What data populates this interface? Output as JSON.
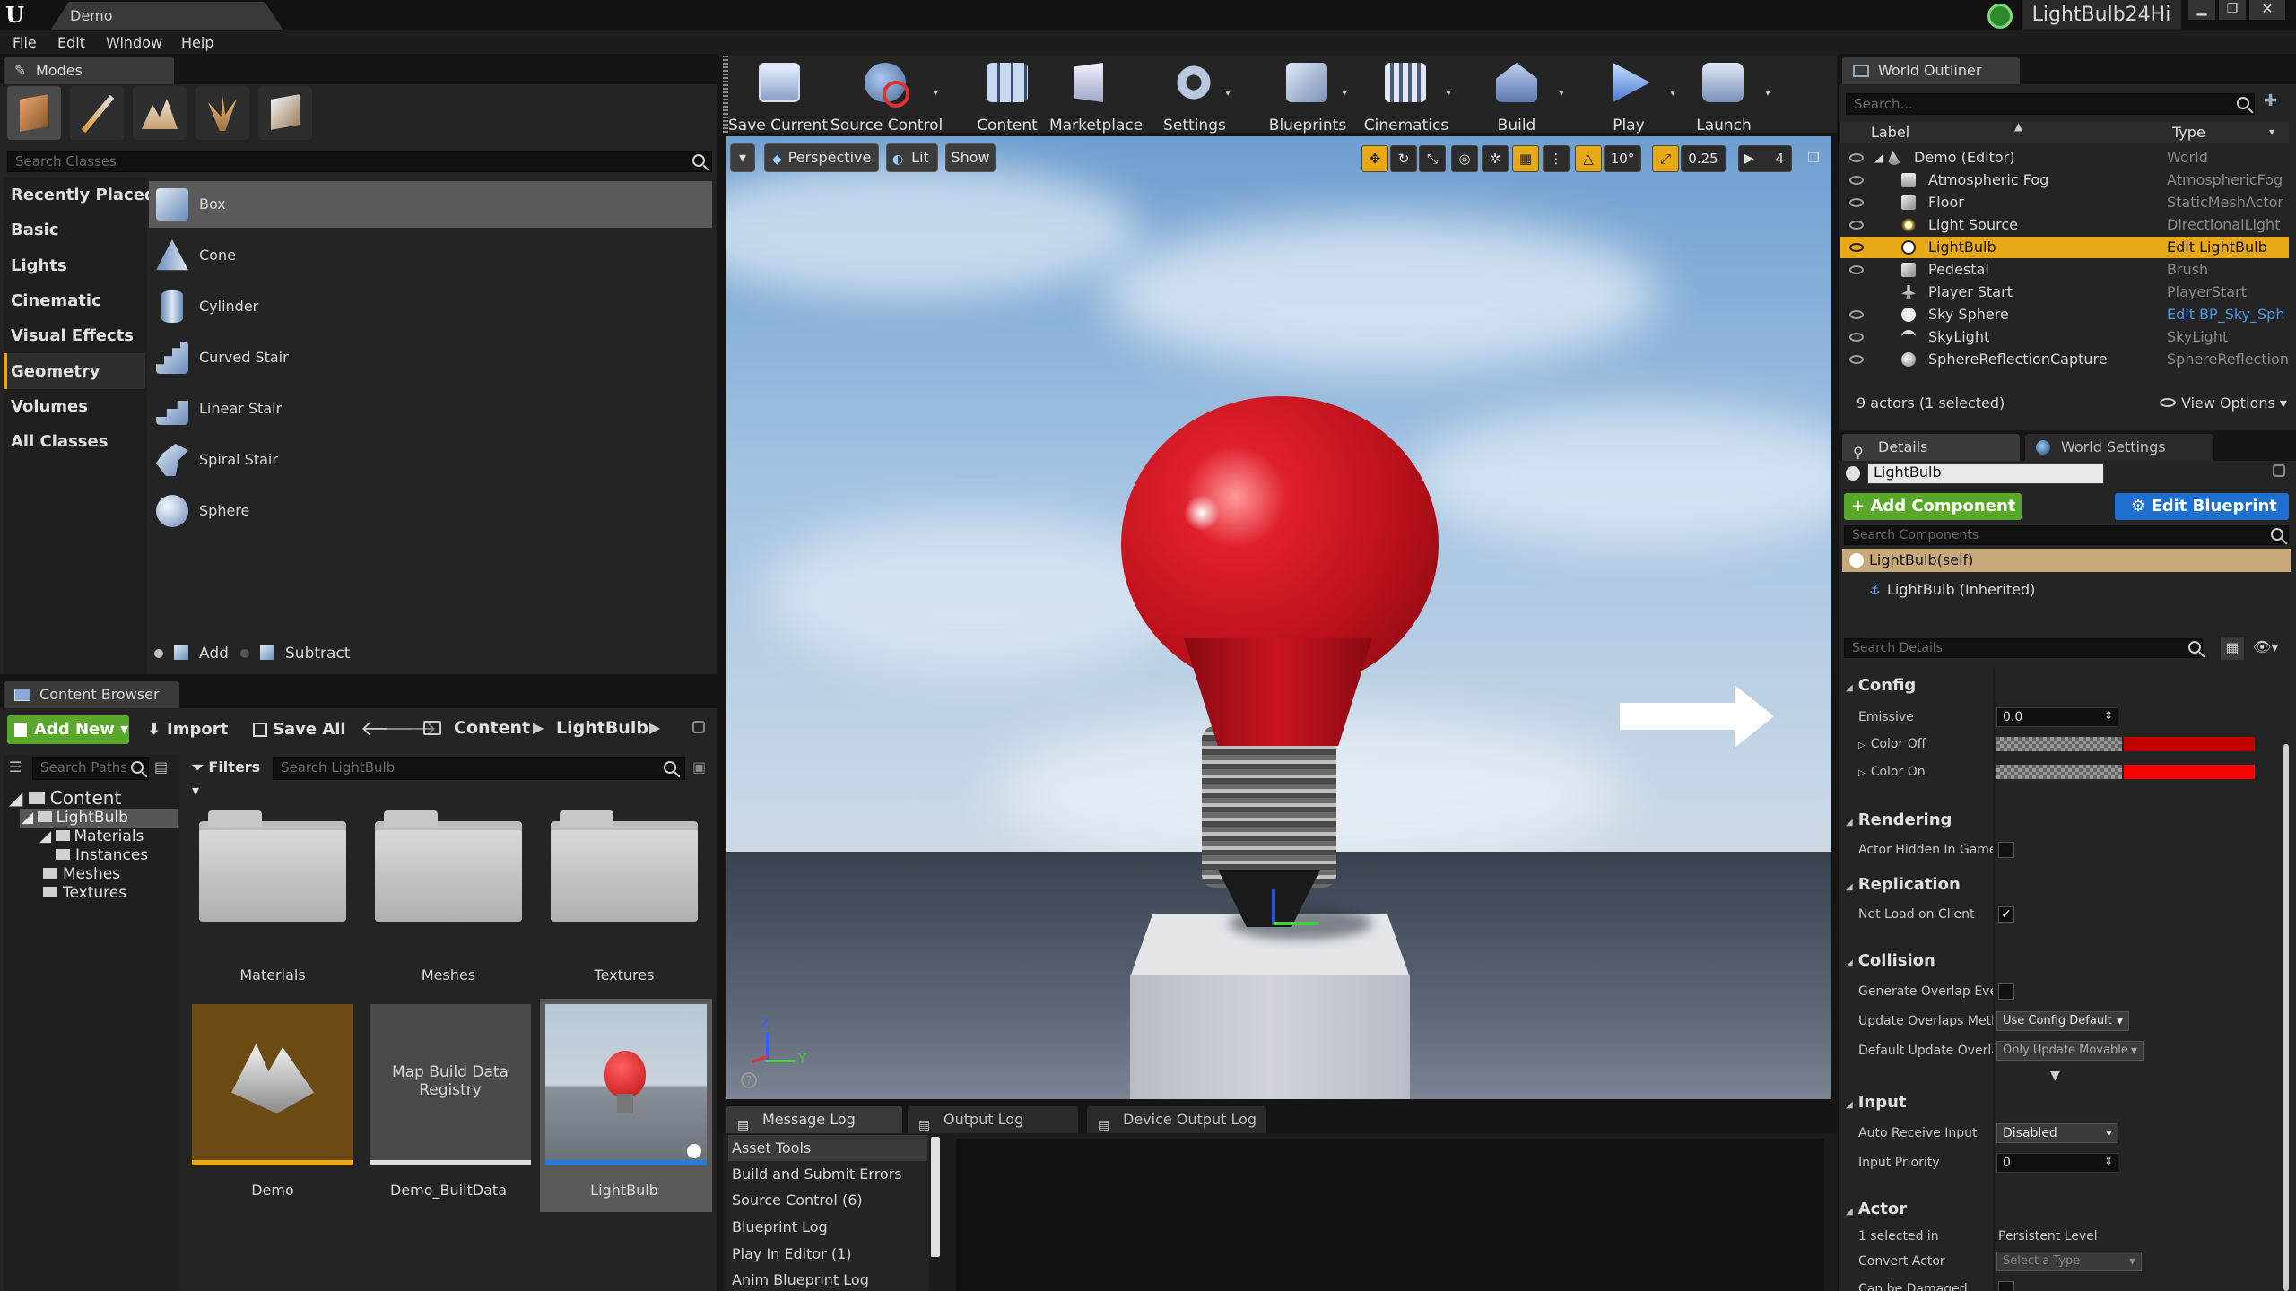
{
  "title_bar": {
    "tab_label": "Demo",
    "project_name": "LightBulb24Hi"
  },
  "menu": [
    "File",
    "Edit",
    "Window",
    "Help"
  ],
  "modes": {
    "title": "Modes",
    "search_placeholder": "Search Classes",
    "categories": [
      "Recently Placed",
      "Basic",
      "Lights",
      "Cinematic",
      "Visual Effects",
      "Geometry",
      "Volumes",
      "All Classes"
    ],
    "selected_category": "Geometry",
    "items": [
      "Box",
      "Cone",
      "Cylinder",
      "Curved Stair",
      "Linear Stair",
      "Spiral Stair",
      "Sphere"
    ],
    "add_label": "Add",
    "subtract_label": "Subtract"
  },
  "toolbar": {
    "buttons": [
      "Save Current",
      "Source Control",
      "Content",
      "Marketplace",
      "Settings",
      "Blueprints",
      "Cinematics",
      "Build",
      "Play",
      "Launch"
    ]
  },
  "viewport": {
    "perspective_label": "Perspective",
    "lit_label": "Lit",
    "show_label": "Show",
    "rotation_snap": "10°",
    "scale_snap": "0.25",
    "camera_speed": "4",
    "axis_z": "Z",
    "axis_y": "Y"
  },
  "outliner": {
    "title": "World Outliner",
    "search_placeholder": "Search...",
    "col_label": "Label",
    "col_type": "Type",
    "rows": [
      {
        "label": "Demo (Editor)",
        "type": "World"
      },
      {
        "label": "Atmospheric Fog",
        "type": "AtmosphericFog"
      },
      {
        "label": "Floor",
        "type": "StaticMeshActor"
      },
      {
        "label": "Light Source",
        "type": "DirectionalLight"
      },
      {
        "label": "LightBulb",
        "type": "Edit LightBulb"
      },
      {
        "label": "Pedestal",
        "type": "Brush"
      },
      {
        "label": "Player Start",
        "type": "PlayerStart"
      },
      {
        "label": "Sky Sphere",
        "type": "Edit BP_Sky_Sph"
      },
      {
        "label": "SkyLight",
        "type": "SkyLight"
      },
      {
        "label": "SphereReflectionCapture",
        "type": "SphereReflectionC"
      }
    ],
    "footer": "9 actors (1 selected)",
    "view_options": "View Options"
  },
  "details": {
    "tab_details": "Details",
    "tab_world_settings": "World Settings",
    "actor_name": "LightBulb",
    "add_component": "Add Component",
    "edit_blueprint": "Edit Blueprint",
    "search_components": "Search Components",
    "self_component": "LightBulb(self)",
    "inherited_component": "LightBulb (Inherited)",
    "search_details": "Search Details",
    "sections": {
      "config": "Config",
      "rendering": "Rendering",
      "replication": "Replication",
      "collision": "Collision",
      "input": "Input",
      "actor": "Actor"
    },
    "props": {
      "emissive": "Emissive",
      "emissive_value": "0.0",
      "color_off": "Color Off",
      "color_on": "Color On",
      "actor_hidden": "Actor Hidden In Game",
      "net_load": "Net Load on Client",
      "gen_overlap": "Generate Overlap Event:",
      "update_overlaps": "Update Overlaps Metho",
      "update_overlaps_value": "Use Config Default",
      "default_update_overlap": "Default Update Overlap",
      "default_update_overlap_value": "Only Update Movable",
      "auto_receive": "Auto Receive Input",
      "auto_receive_value": "Disabled",
      "input_priority": "Input Priority",
      "input_priority_value": "0",
      "selected_in": "1 selected in",
      "selected_in_value": "Persistent Level",
      "convert_actor": "Convert Actor",
      "convert_actor_value": "Select a Type",
      "can_be_damaged": "Can be Damaged"
    }
  },
  "content_browser": {
    "title": "Content Browser",
    "add_new": "Add New",
    "import": "Import",
    "save_all": "Save All",
    "path": [
      "Content",
      "LightBulb"
    ],
    "search_paths": "Search Paths",
    "filters": "Filters",
    "search_assets": "Search LightBulb",
    "tree": [
      "Content",
      "LightBulb",
      "Materials",
      "Instances",
      "Meshes",
      "Textures"
    ],
    "folders": [
      "Materials",
      "Meshes",
      "Textures"
    ],
    "assets": [
      {
        "label": "Demo",
        "thumb_text": ""
      },
      {
        "label": "Demo_BuiltData",
        "thumb_text": "Map Build Data Registry"
      },
      {
        "label": "LightBulb",
        "thumb_text": ""
      }
    ]
  },
  "logs": {
    "tabs": [
      "Message Log",
      "Output Log",
      "Device Output Log"
    ],
    "categories": [
      "Asset Tools",
      "Build and Submit Errors",
      "Source Control (6)",
      "Blueprint Log",
      "Play In Editor (1)",
      "Anim Blueprint Log"
    ]
  },
  "colors": {
    "selection": "#e8a916",
    "accent_green": "#5aa829",
    "accent_blue": "#1f6fd1",
    "bulb_red": "#d41a22"
  }
}
